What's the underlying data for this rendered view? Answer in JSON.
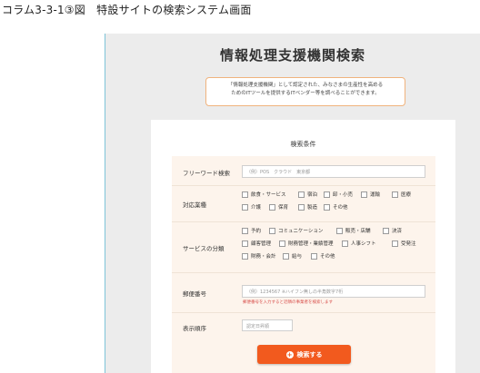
{
  "caption": "コラム3-3-1③図　特設サイトの検索システム画面",
  "page": {
    "title": "情報処理支援機関検索",
    "intro_line1": "「情報処理支援機関」として認定された、みなさまの生産性を高める",
    "intro_line2": "ためのITツールを提供するITベンダー等を調べることができます。"
  },
  "search": {
    "heading": "検索条件",
    "freeword": {
      "label": "フリーワード検索",
      "placeholder": "（例）POS　クラウド　東京都"
    },
    "industry": {
      "label": "対応業種",
      "options": [
        "飲食・サービス",
        "宿泊",
        "卸・小売",
        "運輸",
        "医療",
        "介護",
        "保育",
        "製造",
        "その他"
      ]
    },
    "service": {
      "label": "サービスの分類",
      "options": [
        "予約",
        "コミュニケーション",
        "販売・店舗",
        "決済",
        "顧客管理",
        "財務管理・業績管理",
        "人事シフト",
        "受発注",
        "財務・会計",
        "給与",
        "その他"
      ]
    },
    "postal": {
      "label": "郵便番号",
      "placeholder": "（例）1234567 ※ハイフン無しの半角数字7桁",
      "note": "郵便番号を入力すると近隣の事業者を検索します"
    },
    "order": {
      "label": "表示順序",
      "value": "認定日昇順"
    },
    "button_label": "検索する"
  }
}
